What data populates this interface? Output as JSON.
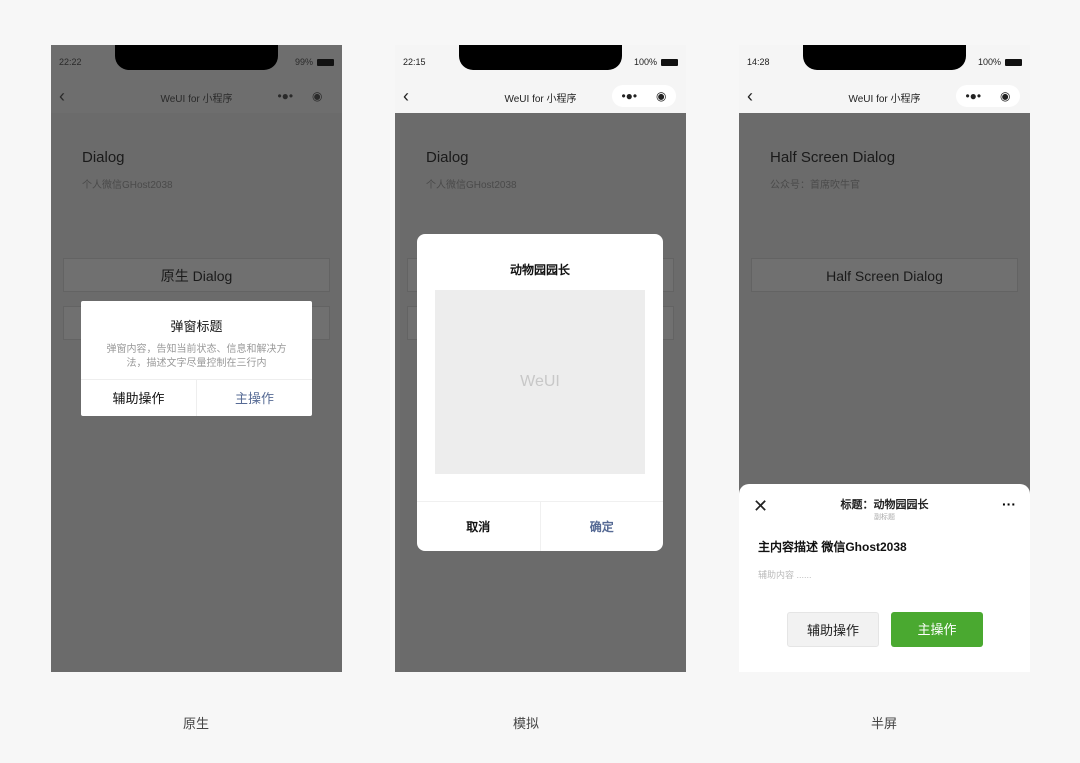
{
  "phones": [
    {
      "time": "22:22",
      "battery": "99%",
      "nav_title": "WeUI for 小程序",
      "heading": "Dialog",
      "subtitle": "个人微信GHost2038",
      "button": "原生 Dialog",
      "dialog": {
        "title": "弹窗标题",
        "body": "弹窗内容，告知当前状态、信息和解决方法，描述文字尽量控制在三行内",
        "secondary": "辅助操作",
        "primary": "主操作"
      },
      "caption": "原生"
    },
    {
      "time": "22:15",
      "battery": "100%",
      "nav_title": "WeUI for 小程序",
      "heading": "Dialog",
      "subtitle": "个人微信GHost2038",
      "dialog": {
        "title": "动物园园长",
        "image_placeholder": "WeUI",
        "cancel": "取消",
        "confirm": "确定"
      },
      "caption": "模拟"
    },
    {
      "time": "14:28",
      "battery": "100%",
      "nav_title": "WeUI for 小程序",
      "heading": "Half Screen Dialog",
      "subtitle": "公众号：首席吹牛官",
      "button": "Half Screen Dialog",
      "sheet": {
        "title": "标题：动物园园长",
        "subtitle": "副标题",
        "main": "主内容描述 微信Ghost2038",
        "aux": "辅助内容 ......",
        "secondary": "辅助操作",
        "primary": "主操作"
      },
      "caption": "半屏"
    }
  ],
  "colors": {
    "primary_link": "#576b95",
    "primary_green": "#4aa930",
    "mask": "#6b6b6b"
  }
}
